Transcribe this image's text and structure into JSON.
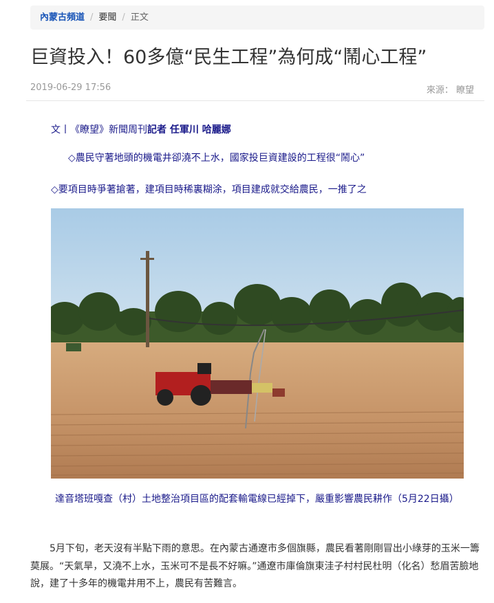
{
  "breadcrumb": {
    "channel": "內蒙古頻道",
    "section": "要聞",
    "current": "正文"
  },
  "article": {
    "title": "巨資投入！60多億“民生工程”為何成“鬧心工程”",
    "date": "2019-06-29 17:56",
    "source": "來源： 瞭望",
    "byline_prefix": "文丨《瞭望》新聞周刊",
    "byline_authors": "記者  任軍川  哈麗娜",
    "bullet_1": "◇農民守著地頭的機電井卻澆不上水，國家投巨資建設的工程很“鬧心”",
    "bullet_2": "◇要項目時爭著搶著，建項目時稀裏糊涂，項目建成就交給農民，一推了之",
    "caption": "達音塔班嘎查（村）土地整治項目區的配套輸電線已經掉下，嚴重影響農民耕作（5月22日攝）",
    "paragraph_1": "5月下旬，老天沒有半點下雨的意思。在內蒙古通遼市多個旗縣，農民看著剛剛冒出小綠芽的玉米一籌莫展。“天氣旱，又澆不上水，玉米可不是長不好嘛。”通遼市庫倫旗東洼子村村民杜明（化名）愁眉苦臉地說，建了十多年的機電井用不上，農民有苦難言。"
  }
}
